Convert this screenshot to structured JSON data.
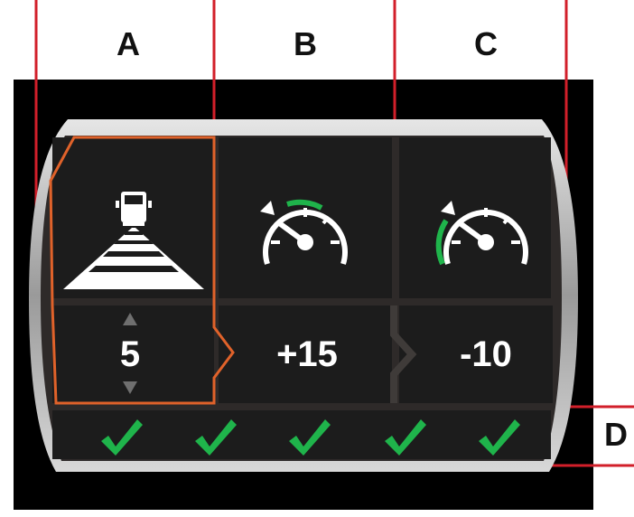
{
  "columns": [
    {
      "label": "A",
      "value": "5",
      "icon": "train-track-icon"
    },
    {
      "label": "B",
      "value": "+15",
      "icon": "speedometer-increase-icon"
    },
    {
      "label": "C",
      "value": "-10",
      "icon": "speedometer-decrease-icon"
    }
  ],
  "row_label": "D",
  "status_checks": [
    "check-icon",
    "check-icon",
    "check-icon",
    "check-icon",
    "check-icon"
  ],
  "colors": {
    "background": "#000000",
    "bezel": "#b9b9b9",
    "cell": "#1c1c1c",
    "divider": "#3f3b39",
    "selection": "#e0622a",
    "accent_green": "#1fb44b",
    "callout_line": "#d21f2a"
  }
}
